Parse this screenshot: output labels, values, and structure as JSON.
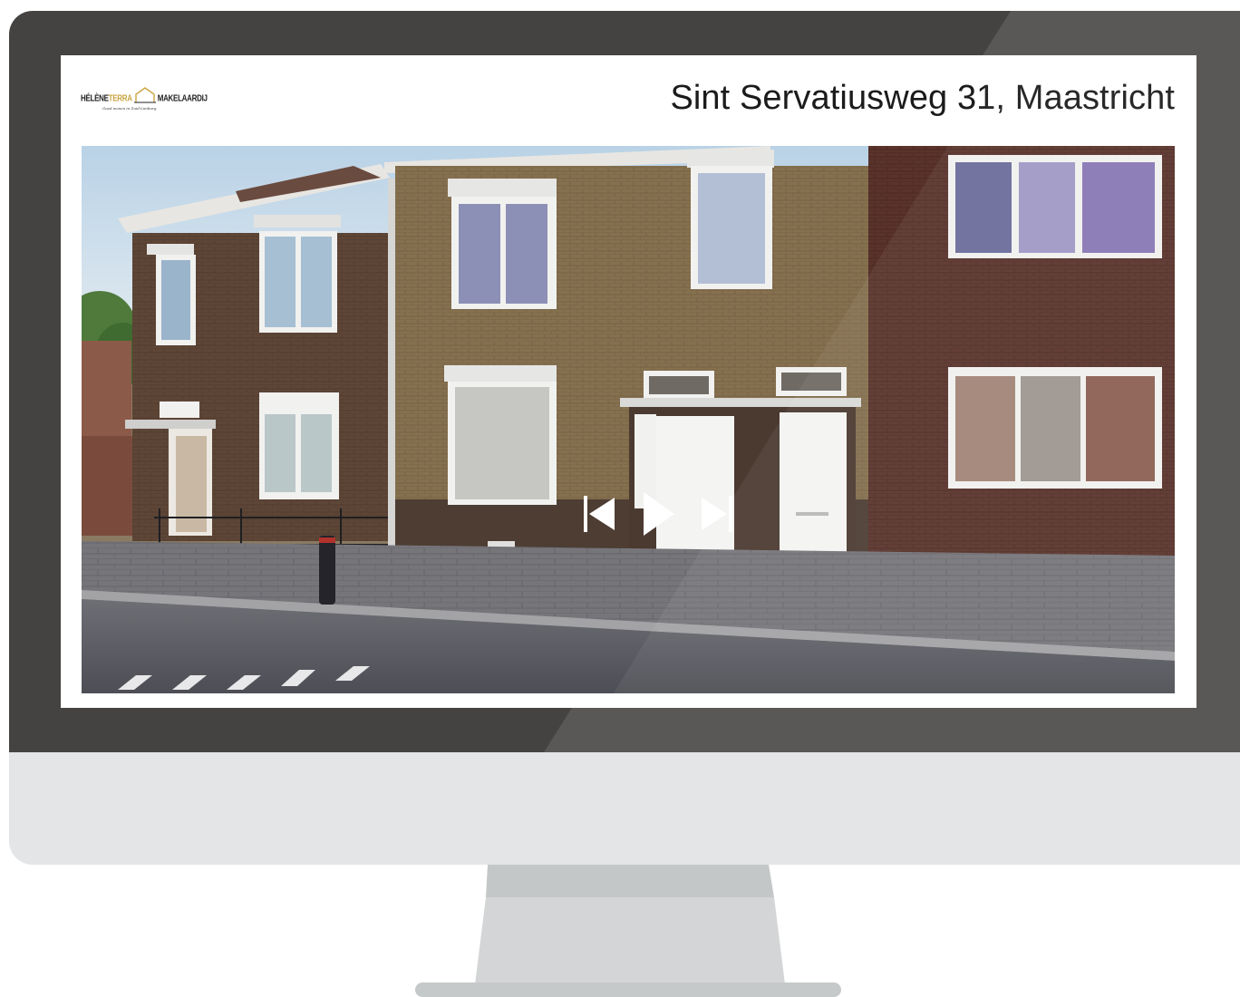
{
  "header": {
    "logo": {
      "word_left": "HÉLÈNE",
      "word_accent": "TERRA",
      "word_right": "MAKELAARDIJ",
      "tagline": "Goed wonen in Zuid-Limburg"
    },
    "title": "Sint Servatiusweg 31, Maastricht"
  },
  "slideshow": {
    "controls": [
      {
        "name": "previous",
        "icon": "skip-previous-icon"
      },
      {
        "name": "play",
        "icon": "play-icon"
      },
      {
        "name": "next",
        "icon": "skip-next-icon"
      }
    ]
  },
  "colors": {
    "bezel": "#454341",
    "chin": "#e4e5e7",
    "stand": "#cfd1d2",
    "screen_bg": "#ffffff",
    "logo_accent": "#c9a441",
    "title_text": "#1b1b1b",
    "control_icons": "#ffffff"
  }
}
